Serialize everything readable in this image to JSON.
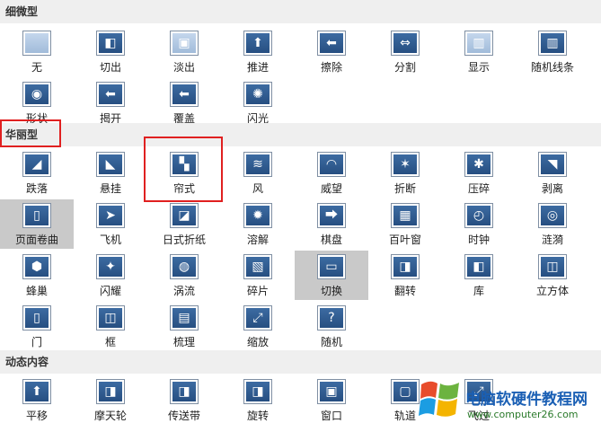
{
  "sections": [
    {
      "title": "细微型",
      "items": [
        "无",
        "切出",
        "淡出",
        "推进",
        "擦除",
        "分割",
        "显示",
        "随机线条",
        "形状",
        "揭开",
        "覆盖",
        "闪光"
      ]
    },
    {
      "title": "华丽型",
      "items": [
        "跌落",
        "悬挂",
        "帘式",
        "风",
        "威望",
        "折断",
        "压碎",
        "剥离",
        "页面卷曲",
        "飞机",
        "日式折纸",
        "溶解",
        "棋盘",
        "百叶窗",
        "时钟",
        "涟漪",
        "蜂巢",
        "闪耀",
        "涡流",
        "碎片",
        "切换",
        "翻转",
        "库",
        "立方体",
        "门",
        "框",
        "梳理",
        "缩放",
        "随机"
      ]
    },
    {
      "title": "动态内容",
      "items": [
        "平移",
        "摩天轮",
        "传送带",
        "旋转",
        "窗口",
        "轨道",
        "飞过"
      ]
    }
  ],
  "selected": [
    "页面卷曲",
    "切换"
  ],
  "highlight_color": "#e02020",
  "watermark": {
    "title": "电脑软硬件教程网",
    "url": "www.computer26.com"
  }
}
